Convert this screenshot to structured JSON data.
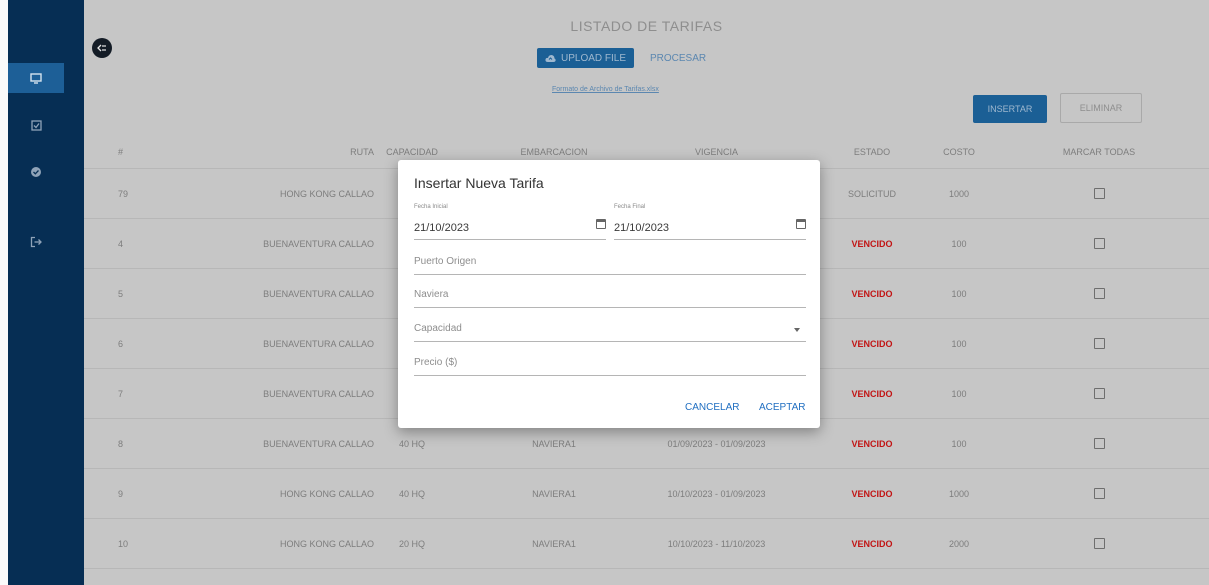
{
  "sidebar": {
    "icons": [
      "monitor-icon",
      "clipboard-check-icon",
      "check-circle-icon",
      "logout-icon"
    ]
  },
  "header": {
    "title": "LISTADO DE TARIFAS",
    "upload_label": "UPLOAD FILE",
    "procesar_label": "PROCESAR",
    "format_link": "Formato de Archivo de Tarifas.xlsx",
    "insert_label": "INSERTAR",
    "delete_label": "ELIMINAR"
  },
  "table": {
    "columns": [
      "#",
      "RUTA",
      "CAPACIDAD",
      "EMBARCACION",
      "VIGENCIA",
      "ESTADO",
      "COSTO",
      "MARCAR TODAS"
    ],
    "rows": [
      {
        "id": "79",
        "ruta": "HONG KONG CALLAO",
        "capacidad": "",
        "embarcacion": "",
        "vigencia": "",
        "estado": "SOLICITUD",
        "costo": "1000"
      },
      {
        "id": "4",
        "ruta": "BUENAVENTURA CALLAO",
        "capacidad": "",
        "embarcacion": "",
        "vigencia": "",
        "estado": "VENCIDO",
        "costo": "100"
      },
      {
        "id": "5",
        "ruta": "BUENAVENTURA CALLAO",
        "capacidad": "",
        "embarcacion": "",
        "vigencia": "",
        "estado": "VENCIDO",
        "costo": "100"
      },
      {
        "id": "6",
        "ruta": "BUENAVENTURA CALLAO",
        "capacidad": "",
        "embarcacion": "",
        "vigencia": "",
        "estado": "VENCIDO",
        "costo": "100"
      },
      {
        "id": "7",
        "ruta": "BUENAVENTURA CALLAO",
        "capacidad": "",
        "embarcacion": "",
        "vigencia": "",
        "estado": "VENCIDO",
        "costo": "100"
      },
      {
        "id": "8",
        "ruta": "BUENAVENTURA CALLAO",
        "capacidad": "40 HQ",
        "embarcacion": "NAVIERA1",
        "vigencia": "01/09/2023 - 01/09/2023",
        "estado": "VENCIDO",
        "costo": "100"
      },
      {
        "id": "9",
        "ruta": "HONG KONG CALLAO",
        "capacidad": "40 HQ",
        "embarcacion": "NAVIERA1",
        "vigencia": "10/10/2023 - 01/09/2023",
        "estado": "VENCIDO",
        "costo": "1000"
      },
      {
        "id": "10",
        "ruta": "HONG KONG CALLAO",
        "capacidad": "20 HQ",
        "embarcacion": "NAVIERA1",
        "vigencia": "10/10/2023 - 11/10/2023",
        "estado": "VENCIDO",
        "costo": "2000"
      }
    ]
  },
  "dialog": {
    "title": "Insertar Nueva Tarifa",
    "start_label": "Fecha Inicial",
    "start_value": "21/10/2023",
    "end_label": "Fecha Final",
    "end_value": "21/10/2023",
    "puerto_placeholder": "Puerto Origen",
    "naviera_placeholder": "Naviera",
    "capacidad_placeholder": "Capacidad",
    "precio_placeholder": "Precio ($)",
    "cancel_label": "CANCELAR",
    "accept_label": "ACEPTAR"
  }
}
